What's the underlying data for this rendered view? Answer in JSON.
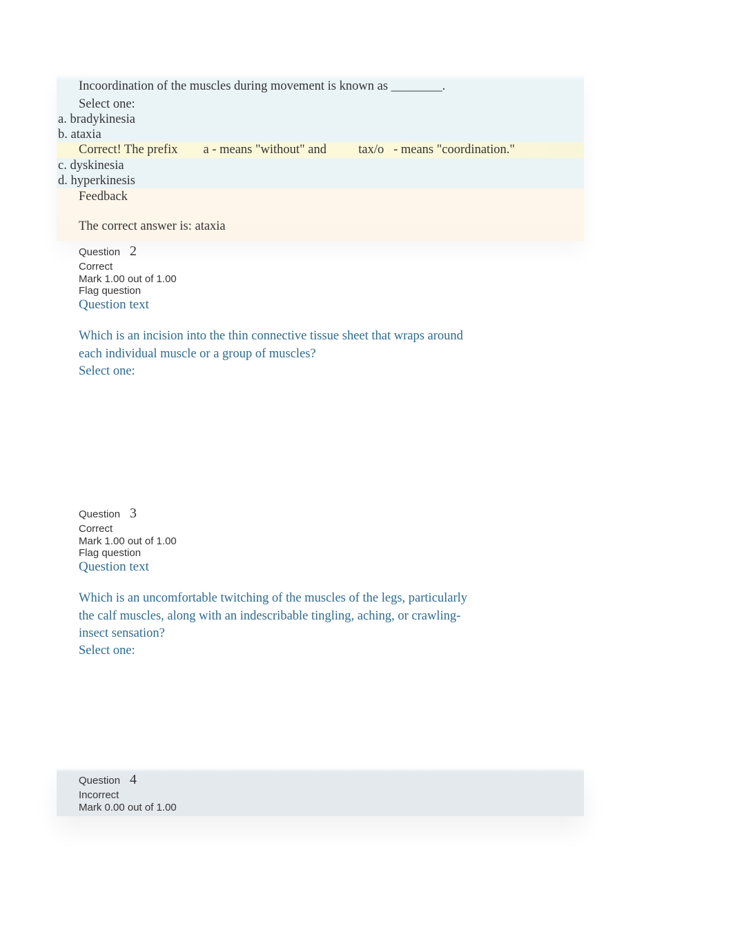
{
  "q1": {
    "prompt": "Incoordination of the muscles during movement is known as ________.",
    "select_one": "Select one:",
    "options": {
      "a": "a. bradykinesia",
      "b": "b. ataxia",
      "c": "c. dyskinesia",
      "d": "d. hyperkinesis"
    },
    "correct_line": "Correct! The prefix        a - means \"without\" and          tax/o   - means \"coordination.\"",
    "feedback_title": "Feedback",
    "feedback_answer": "The correct answer is: ataxia"
  },
  "q2": {
    "question_label": "Question",
    "number": "2",
    "status": "Correct",
    "mark": "Mark 1.00 out of 1.00",
    "flag": "Flag question",
    "text_heading": "Question text",
    "prompt": "Which is an incision into the thin connective tissue sheet that wraps around each individual muscle or a group of muscles?",
    "select_one": "Select one:"
  },
  "q3": {
    "question_label": "Question",
    "number": "3",
    "status": "Correct",
    "mark": "Mark 1.00 out of 1.00",
    "flag": "Flag question",
    "text_heading": "Question text",
    "prompt": "Which is an uncomfortable twitching of the muscles of the legs, particularly the calf muscles, along with an indescribable tingling, aching, or crawling-insect sensation?",
    "select_one": "Select one:"
  },
  "q4": {
    "question_label": "Question",
    "number": "4",
    "status": "Incorrect",
    "mark": "Mark 0.00 out of 1.00"
  }
}
